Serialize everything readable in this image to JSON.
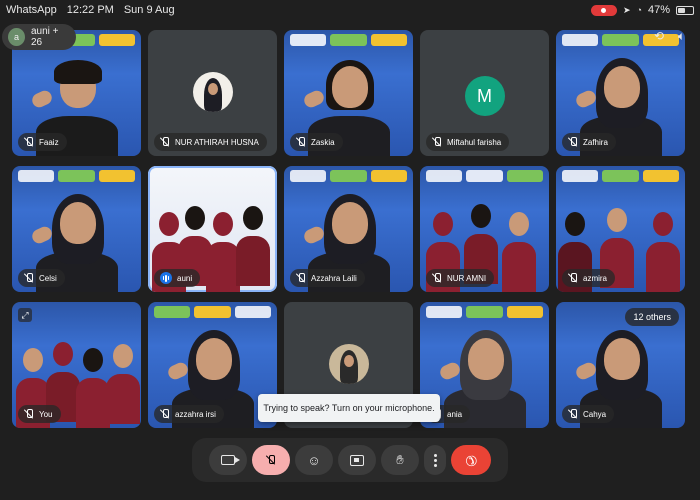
{
  "status_bar": {
    "app": "WhatsApp",
    "time": "12:22 PM",
    "date": "Sun 9 Aug",
    "battery": "47%",
    "battery_level": 0.47
  },
  "meeting": {
    "participants_label": "auni + 26"
  },
  "tiles": [
    {
      "name": "Faaiz",
      "muted": true,
      "type": "video",
      "bg": "blue"
    },
    {
      "name": "NUR ATHIRAH HUSNA",
      "muted": true,
      "type": "photo-avatar",
      "bg": "grey"
    },
    {
      "name": "Zaskia",
      "muted": true,
      "type": "video",
      "bg": "blue"
    },
    {
      "name": "Miftahul farisha",
      "muted": true,
      "type": "letter-avatar",
      "letter": "M",
      "bg": "grey"
    },
    {
      "name": "Zafhira",
      "muted": true,
      "type": "video",
      "bg": "blue"
    },
    {
      "name": "Celsi",
      "muted": true,
      "type": "video",
      "bg": "blue"
    },
    {
      "name": "auni",
      "muted": false,
      "speaking": true,
      "type": "group-video",
      "bg": "white",
      "active": true
    },
    {
      "name": "Azzahra Laili",
      "muted": true,
      "type": "video",
      "bg": "blue"
    },
    {
      "name": "NUR AMNI",
      "muted": true,
      "type": "group-video",
      "bg": "blue"
    },
    {
      "name": "azmira",
      "muted": true,
      "type": "group-video",
      "bg": "blue"
    },
    {
      "name": "You",
      "muted": true,
      "type": "group-video",
      "bg": "blue",
      "self": true
    },
    {
      "name": "azzahra irsi",
      "muted": true,
      "type": "video",
      "bg": "blue"
    },
    {
      "name": "",
      "muted": true,
      "type": "photo-avatar",
      "bg": "grey"
    },
    {
      "name": "ania",
      "muted": true,
      "type": "video",
      "bg": "blue"
    },
    {
      "name": "Cahya",
      "muted": true,
      "type": "video",
      "bg": "blue",
      "others_label": "12 others"
    }
  ],
  "toast": {
    "text": "Trying to speak? Turn on your microphone."
  },
  "controls": {
    "camera_icon": "camera-icon",
    "mic_icon": "mic-off-icon",
    "emoji_icon": "emoji-icon",
    "present_icon": "present-icon",
    "hand_icon": "raise-hand-icon",
    "more_icon": "more-vert-icon",
    "end_icon": "end-call-icon"
  },
  "colors": {
    "mic_off_bg": "#f6aeae",
    "end_call": "#ea4335",
    "active_speaker": "#8ab4f8",
    "avatar_green": "#12a37f"
  }
}
